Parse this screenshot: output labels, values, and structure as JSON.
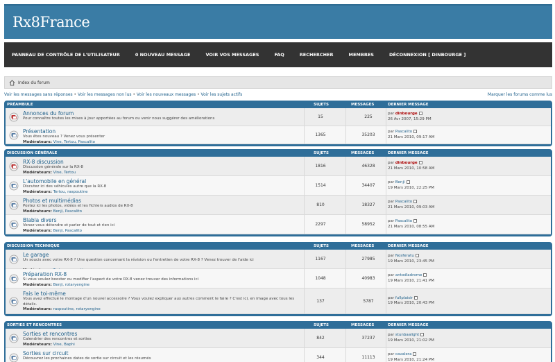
{
  "site": {
    "logo": "Rx8France"
  },
  "nav": [
    "PANNEAU DE CONTRÔLE DE L'UTILISATEUR",
    "0 NOUVEAU MESSAGE",
    "VOIR VOS MESSAGES",
    "FAQ",
    "RECHERCHER",
    "MEMBRES",
    "DÉCONNEXION [ DINBOURGE ]"
  ],
  "breadcrumb": {
    "label": "Index du forum"
  },
  "links": {
    "items": [
      "Voir les messages sans réponses",
      "Voir les messages non lus",
      "Voir les nouveaux messages",
      "Voir les sujets actifs"
    ],
    "separator": " • ",
    "mark_read": "Marquer les forums comme lus"
  },
  "columns": {
    "topics": "SUJETS",
    "posts": "MESSAGES",
    "last": "DERNIER MESSAGE"
  },
  "moderators_label": "Modérateurs:",
  "by_label": "par",
  "categories": [
    {
      "name": "Préambule",
      "forums": [
        {
          "title": "Annonces du forum",
          "desc": "Pour connaître toutes les mises à jour apportées au forum ou venir nous suggérer des améliorations",
          "mods": "",
          "topics": "15",
          "posts": "225",
          "last_user": "dinbourge",
          "last_date": "26 Avr 2007, 15:29 PM",
          "red": true
        },
        {
          "title": "Présentation",
          "desc": "Vous êtes nouveau ? Venez vous présenter",
          "mods": "Vine, Tertou, Pascalito",
          "topics": "1365",
          "posts": "35203",
          "last_user": "Pascalito",
          "last_date": "21 Mars 2010, 09:17 AM",
          "red": false
        }
      ]
    },
    {
      "name": "Discussion générale",
      "forums": [
        {
          "title": "RX-8 discussion",
          "desc": "Discussion générale sur la RX-8",
          "mods": "Vine, Tertou",
          "topics": "1816",
          "posts": "46328",
          "last_user": "dinbourge",
          "last_date": "21 Mars 2010, 10:58 AM",
          "red": true
        },
        {
          "title": "L'automobile en général",
          "desc": "Discutez ici des véhicules autre que la RX-8",
          "mods": "Tertou, raspoutine",
          "topics": "1514",
          "posts": "34407",
          "last_user": "Benji",
          "last_date": "19 Mars 2010, 22:25 PM",
          "red": false
        },
        {
          "title": "Photos et multimédias",
          "desc": "Postez ici les photos, vidéos et les fichiers audios de RX-8",
          "mods": "Benji, Pascalito",
          "topics": "810",
          "posts": "18327",
          "last_user": "Pascalito",
          "last_date": "21 Mars 2010, 09:03 AM",
          "red": false
        },
        {
          "title": "Blabla divers",
          "desc": "Venez vous détendre et parler de tout et rien ici",
          "mods": "Benji, Pascalito",
          "topics": "2297",
          "posts": "58952",
          "last_user": "Pascalito",
          "last_date": "21 Mars 2010, 08:55 AM",
          "red": false
        }
      ]
    },
    {
      "name": "Discussion technique",
      "forums": [
        {
          "title": "Le garage",
          "desc": "Un soucis avec votre RX-8 ? Une question concernant la révision ou l'entretien de votre RX-8 ? Venez trouver de l'aide ici",
          "mods": "Tertou, raspoutine",
          "topics": "1167",
          "posts": "27985",
          "last_user": "Nosferatu",
          "last_date": "19 Mars 2010, 23:45 PM",
          "red": false
        },
        {
          "title": "Préparation RX-8",
          "desc": "Si vous voulez booster ou modifier l'aspect de votre RX-8 venez trouver des informations ici",
          "mods": "Benji, rotaryengine",
          "topics": "1048",
          "posts": "40983",
          "last_user": "antodladrome",
          "last_date": "19 Mars 2010, 21:41 PM",
          "red": false
        },
        {
          "title": "Fais le toi-même",
          "desc": "Vous avez effectué le montage d'un nouvel accessoire ? Vous voulez expliquer aux autres comment le faire ? C'est ici, en image avec tous les détails.",
          "mods": "raspoutine, rotaryengine",
          "topics": "137",
          "posts": "5787",
          "last_user": "fullplaisir",
          "last_date": "19 Mars 2010, 20:43 PM",
          "red": false
        }
      ]
    },
    {
      "name": "Sorties et rencontres",
      "forums": [
        {
          "title": "Sorties et rencontres",
          "desc": "Calendrier des rencontres et sorties",
          "mods": "Vine, Baphi",
          "topics": "842",
          "posts": "37237",
          "last_user": "stunbaalight",
          "last_date": "19 Mars 2010, 21:02 PM",
          "red": false
        },
        {
          "title": "Sorties sur circuit",
          "desc": "Découvrez les prochaines dates de sortie sur circuit et les résumés",
          "mods": "",
          "topics": "344",
          "posts": "11113",
          "last_user": "cavalera",
          "last_date": "19 Mars 2010, 21:24 PM",
          "red": false
        }
      ]
    }
  ]
}
